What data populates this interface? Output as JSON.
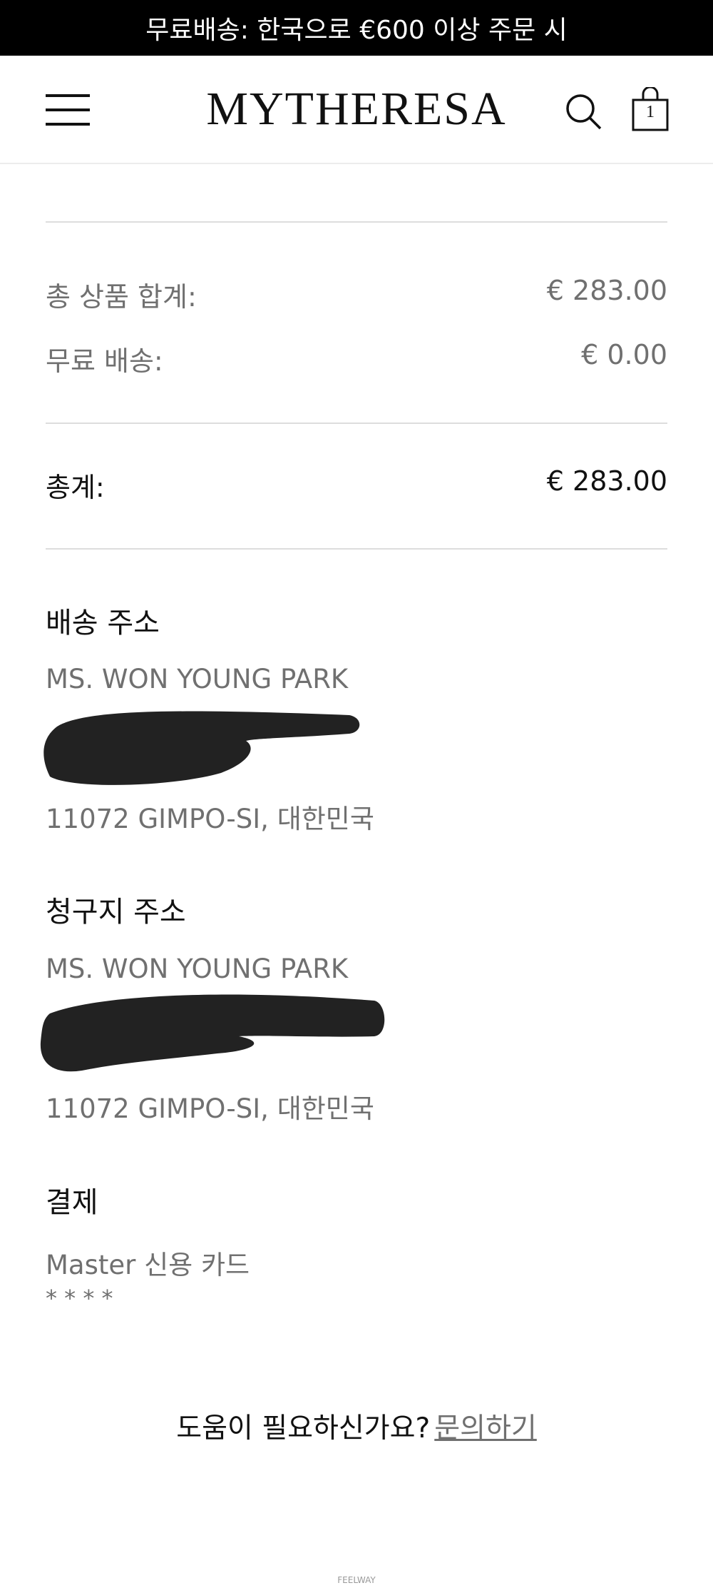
{
  "promo_banner": "무료배송: 한국으로 €600 이상 주문 시",
  "header": {
    "logo": "MYTHERESA",
    "cart_count": "1"
  },
  "summary": {
    "subtotal_label": "총 상품 합계:",
    "subtotal_value": "€ 283.00",
    "shipping_label": "무료 배송:",
    "shipping_value": "€ 0.00",
    "total_label": "총계:",
    "total_value": "€ 283.00"
  },
  "shipping_address": {
    "title": "배송 주소",
    "name": "MS. WON YOUNG PARK",
    "city": "11072 GIMPO-SI, 대한민국"
  },
  "billing_address": {
    "title": "청구지 주소",
    "name": "MS. WON YOUNG PARK",
    "city": "11072 GIMPO-SI, 대한민국"
  },
  "payment": {
    "title": "결제",
    "method": "Master 신용 카드",
    "card_mask": "* * * *"
  },
  "help": {
    "question": "도움이 필요하신가요?",
    "link": "문의하기"
  },
  "watermark": "FEELWAY"
}
